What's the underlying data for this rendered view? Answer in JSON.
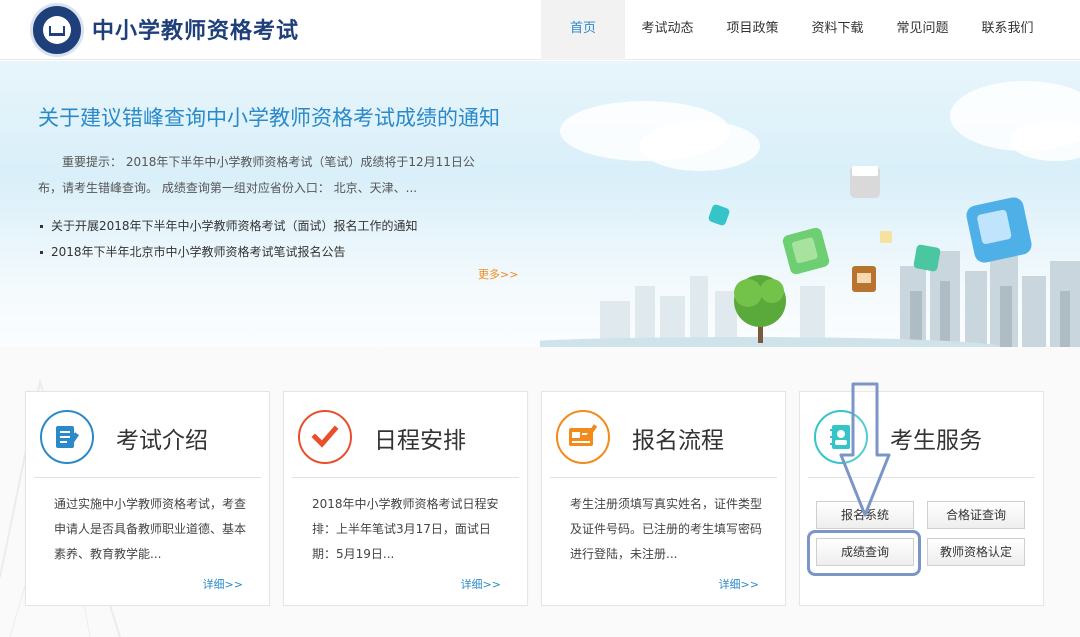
{
  "header": {
    "site_title": "中小学教师资格考试",
    "nav": [
      "首页",
      "考试动态",
      "项目政策",
      "资料下载",
      "常见问题",
      "联系我们"
    ],
    "active_index": 0
  },
  "banner": {
    "title": "关于建议错峰查询中小学教师资格考试成绩的通知",
    "summary": "重要提示： 2018年下半年中小学教师资格考试（笔试）成绩将于12月11日公布，请考生错峰查询。 成绩查询第一组对应省份入口： 北京、天津、...",
    "news": [
      "关于开展2018年下半年中小学教师资格考试（面试）报名工作的通知",
      "2018年下半年北京市中小学教师资格考试笔试报名公告"
    ],
    "more": "更多>>"
  },
  "cards": [
    {
      "title": "考试介绍",
      "icon": "document-edit-icon",
      "body": "通过实施中小学教师资格考试，考查申请人是否具备教师职业道德、基本素养、教育教学能...",
      "more": "详细>>"
    },
    {
      "title": "日程安排",
      "icon": "checkmark-icon",
      "body": "2018年中小学教师资格考试日程安排：上半年笔试3月17日，面试日期：5月19日...",
      "more": "详细>>"
    },
    {
      "title": "报名流程",
      "icon": "registration-form-icon",
      "body": "考生注册须填写真实姓名，证件类型及证件号码。已注册的考生填写密码进行登陆，未注册...",
      "more": "详细>>"
    },
    {
      "title": "考生服务",
      "icon": "contact-book-icon"
    }
  ],
  "services": {
    "buttons": [
      "报名系统",
      "合格证查询",
      "成绩查询",
      "教师资格认定"
    ]
  },
  "colors": {
    "brand": "#1e3f7a",
    "accent": "#2a8ac9",
    "orange": "#f28a1c",
    "red": "#e8502d"
  }
}
